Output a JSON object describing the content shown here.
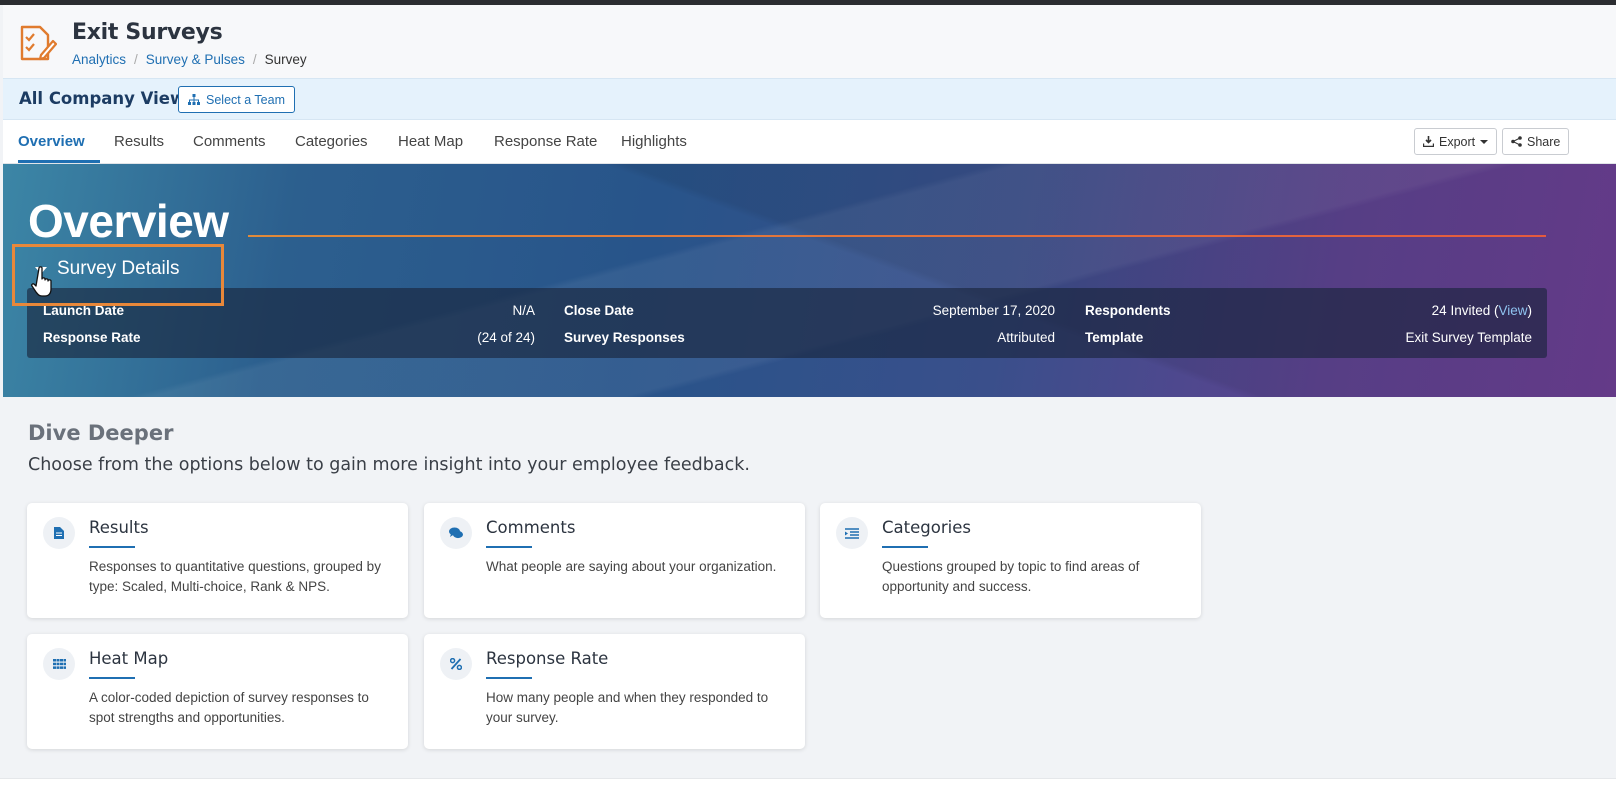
{
  "app": {
    "title": "Exit Surveys",
    "icon": "survey-checklist-icon"
  },
  "breadcrumb": {
    "items": [
      "Analytics",
      "Survey & Pulses"
    ],
    "current": "Survey"
  },
  "company_bar": {
    "title": "All Company View",
    "select_team_label": "Select a Team"
  },
  "tabs": {
    "items": [
      "Overview",
      "Results",
      "Comments",
      "Categories",
      "Heat Map",
      "Response Rate",
      "Highlights"
    ],
    "active": "Overview",
    "export_label": "Export",
    "share_label": "Share"
  },
  "banner": {
    "title": "Overview",
    "details_toggle": "Survey Details",
    "details": {
      "launch_date_label": "Launch Date",
      "launch_date_value": "N/A",
      "close_date_label": "Close Date",
      "close_date_value": "September 17, 2020",
      "respondents_label": "Respondents",
      "respondents_value": "24 Invited (",
      "respondents_link": "View",
      "respondents_close": ")",
      "response_rate_label": "Response Rate",
      "response_rate_value": "(24 of 24)",
      "survey_responses_label": "Survey Responses",
      "survey_responses_value": "Attributed",
      "template_label": "Template",
      "template_value": "Exit Survey Template"
    }
  },
  "dive": {
    "title": "Dive Deeper",
    "subtitle": "Choose from the options below to gain more insight into your employee feedback.",
    "cards": [
      {
        "title": "Results",
        "desc": "Responses to quantitative questions, grouped by type: Scaled, Multi-choice, Rank & NPS.",
        "icon": "document-icon"
      },
      {
        "title": "Comments",
        "desc": "What people are saying about your organization.",
        "icon": "chat-bubbles-icon"
      },
      {
        "title": "Categories",
        "desc": "Questions grouped by topic to find areas of opportunity and success.",
        "icon": "indent-list-icon"
      },
      {
        "title": "Heat Map",
        "desc": "A color-coded depiction of survey responses to spot strengths and opportunities.",
        "icon": "grid-icon"
      },
      {
        "title": "Response Rate",
        "desc": "How many people and when they responded to your survey.",
        "icon": "percent-icon"
      }
    ]
  },
  "colors": {
    "accent": "#1f6fb2",
    "highlight": "#e8883a",
    "brand_icon": "#e07b2e"
  }
}
